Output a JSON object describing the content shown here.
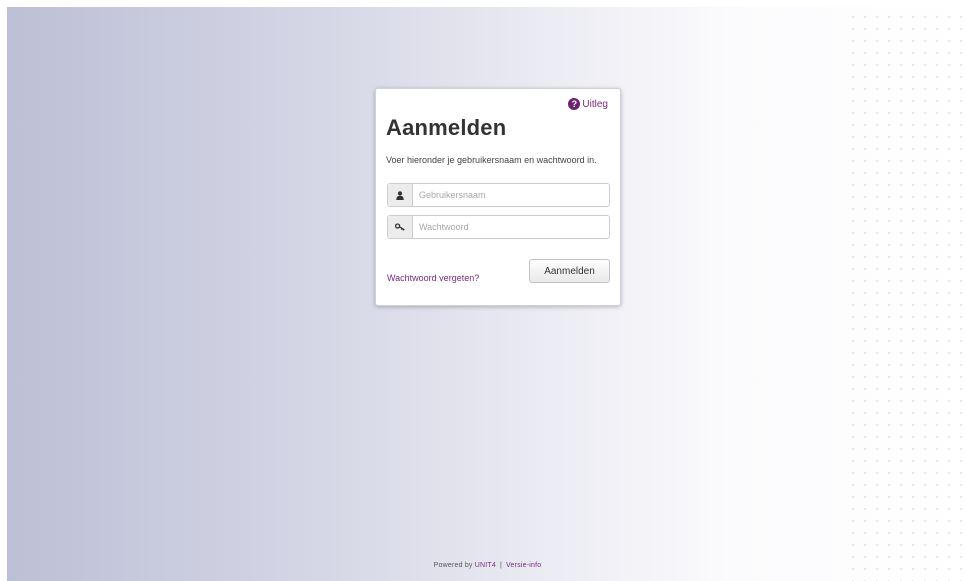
{
  "login": {
    "help_label": "Uitleg",
    "help_icon": "question-circle-icon",
    "title": "Aanmelden",
    "instruction": "Voer hieronder je gebruikersnaam en wachtwoord in.",
    "username": {
      "placeholder": "Gebruikersnaam",
      "value": "",
      "icon": "user-icon"
    },
    "password": {
      "placeholder": "Wachtwoord",
      "value": "",
      "icon": "key-icon"
    },
    "forgot_label": "Wachtwoord vergeten?",
    "submit_label": "Aanmelden"
  },
  "footer": {
    "powered_by": "Powered by",
    "brand": "UNIT4",
    "separator": "|",
    "version_label": "Versie-info"
  },
  "colors": {
    "accent": "#7a2a7e",
    "help_icon_bg": "#6b2370",
    "title_text": "#333333"
  }
}
